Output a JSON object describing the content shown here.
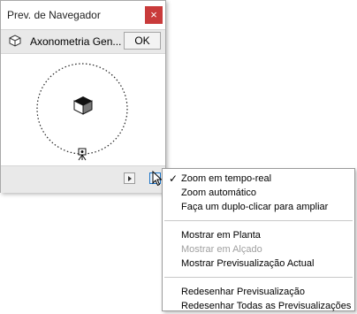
{
  "palette": {
    "title": "Prev. de Navegador",
    "close_glyph": "×",
    "view_name": "Axonometria Gen...",
    "ok_label": "OK",
    "icons": [
      "cube-view-icon",
      "close-icon",
      "house-model-icon",
      "camera-tripod-icon",
      "play-icon",
      "menu-arrow-icon"
    ]
  },
  "menu": {
    "items": [
      {
        "label": "Zoom em tempo-real",
        "checked": true,
        "enabled": true
      },
      {
        "label": "Zoom automático",
        "checked": false,
        "enabled": true
      },
      {
        "label": "Faça um duplo-clicar para ampliar",
        "checked": false,
        "enabled": true
      },
      {
        "label": "Mostrar em Planta",
        "checked": false,
        "enabled": true
      },
      {
        "label": "Mostrar em Alçado",
        "checked": false,
        "enabled": false
      },
      {
        "label": "Mostrar Previsualização Actual",
        "checked": false,
        "enabled": true
      },
      {
        "label": "Redesenhar Previsualização",
        "checked": false,
        "enabled": true
      },
      {
        "label": "Redesenhar Todas as Previsualizações",
        "checked": false,
        "enabled": true
      }
    ],
    "check_glyph": "✓"
  },
  "colors": {
    "close_button": "#c93b3b",
    "toolbar_bg": "#e9e9e9",
    "disabled_text": "#a0a0a0"
  }
}
